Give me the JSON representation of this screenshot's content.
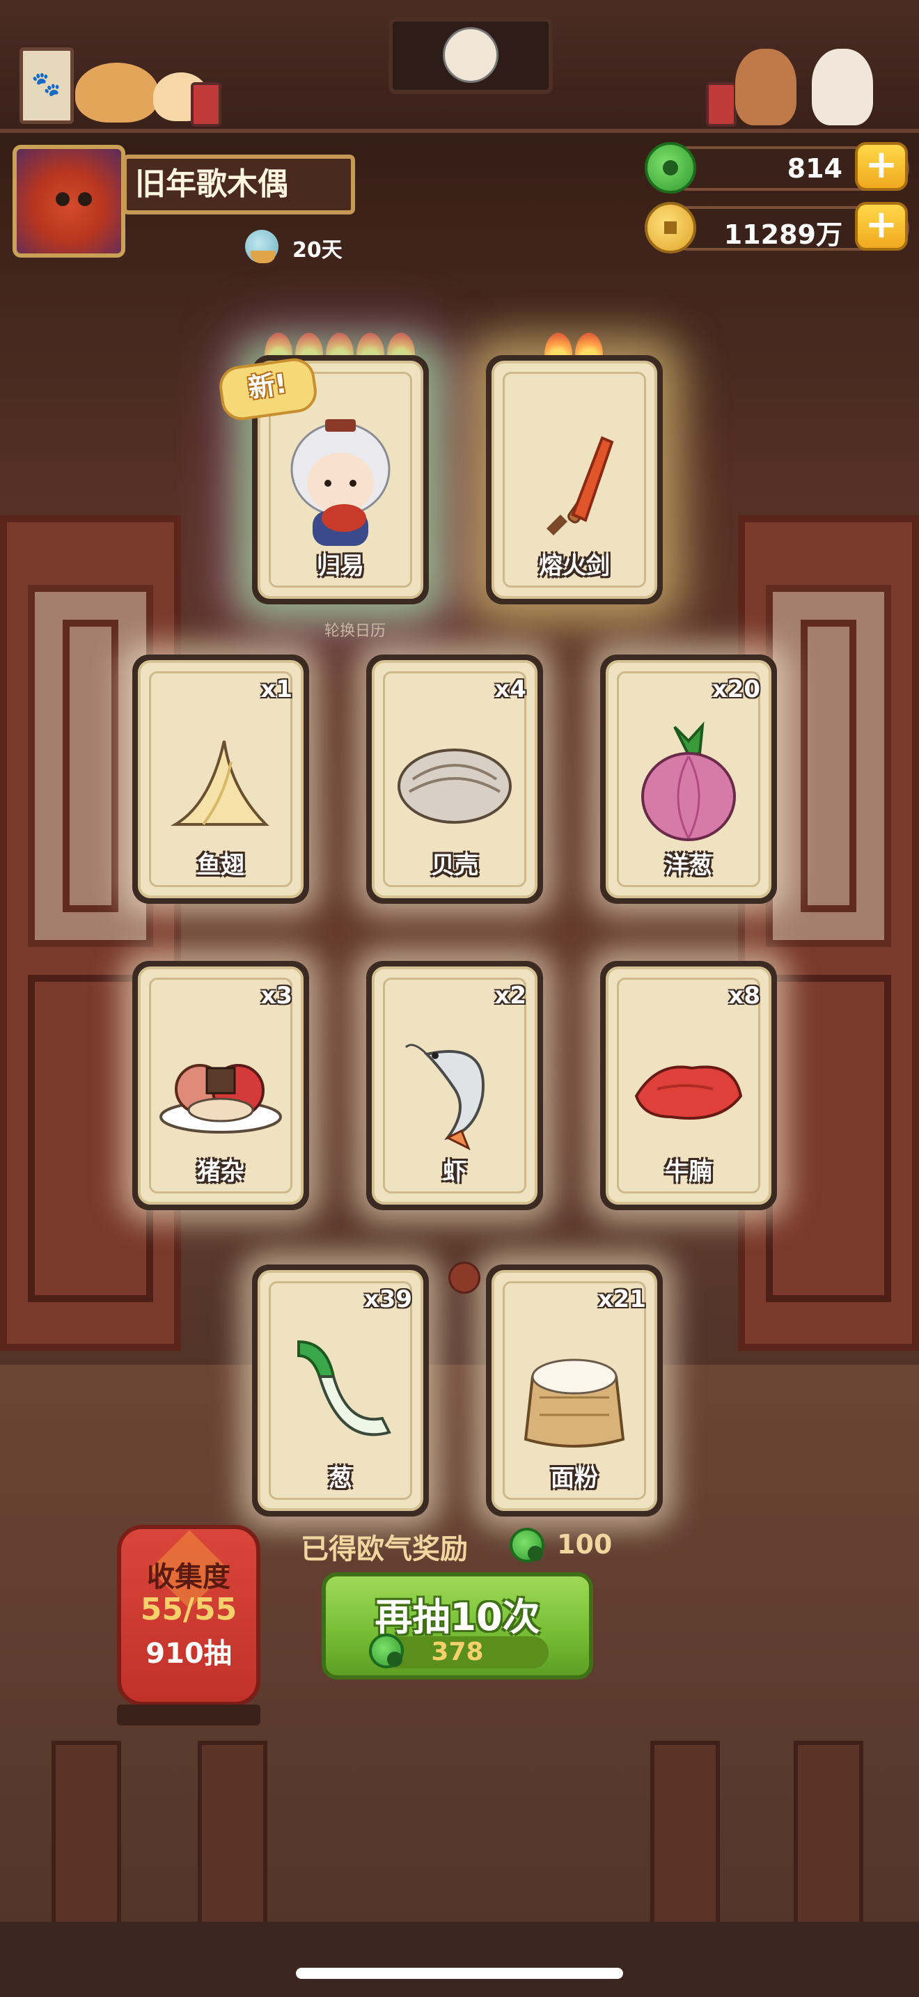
{
  "player": {
    "name": "旧年歌木偶",
    "days": "20天"
  },
  "currency": {
    "jade": "814",
    "coins": "11289万"
  },
  "featured_cards": [
    {
      "label": "归易",
      "flames": 5,
      "is_new": true,
      "new_label": "新!",
      "icon": "character-portrait-icon"
    },
    {
      "label": "熔火剑",
      "flames": 2,
      "icon": "sword-icon"
    }
  ],
  "rotation_label": "轮换日历",
  "cards": [
    {
      "label": "鱼翅",
      "count": "x1",
      "icon": "shark-fin-icon"
    },
    {
      "label": "贝壳",
      "count": "x4",
      "icon": "clam-shell-icon"
    },
    {
      "label": "洋葱",
      "count": "x20",
      "icon": "onion-icon"
    },
    {
      "label": "猪杂",
      "count": "x3",
      "icon": "pork-offal-icon"
    },
    {
      "label": "虾",
      "count": "x2",
      "icon": "shrimp-icon"
    },
    {
      "label": "牛腩",
      "count": "x8",
      "icon": "beef-brisket-icon"
    },
    {
      "label": "葱",
      "count": "x39",
      "icon": "scallion-icon"
    },
    {
      "label": "面粉",
      "count": "x21",
      "icon": "flour-sack-icon"
    }
  ],
  "reward": {
    "text": "已得欧气奖励",
    "amount": "100"
  },
  "collection": {
    "title": "收集度",
    "progress": "55/55",
    "draws": "910抽"
  },
  "draw_button": {
    "label": "再抽10次",
    "cost": "378"
  },
  "colors": {
    "accent_green": "#78bf36",
    "gold_text": "#f6d06a",
    "card_bg": "#efe2c0",
    "lantern_red": "#c1322a"
  }
}
